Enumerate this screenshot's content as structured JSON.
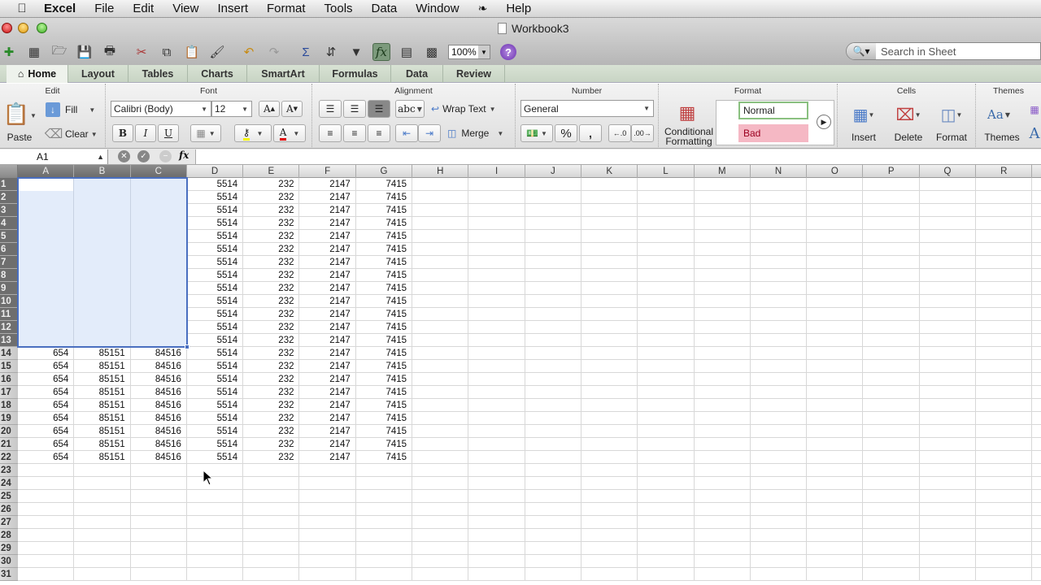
{
  "menubar": {
    "app": "Excel",
    "items": [
      "File",
      "Edit",
      "View",
      "Insert",
      "Format",
      "Tools",
      "Data",
      "Window",
      "Help"
    ]
  },
  "window": {
    "title": "Workbook3"
  },
  "toolbar": {
    "icons": [
      "new-icon",
      "templates-icon",
      "open-icon",
      "save-icon",
      "print-icon",
      "cut-icon",
      "copy-icon",
      "paste-icon",
      "format-painter-icon",
      "undo-icon",
      "redo-icon",
      "autosum-icon",
      "sort-icon",
      "filter-icon",
      "formula-builder-icon",
      "toolbox-icon",
      "media-browser-icon"
    ],
    "zoom": "100%",
    "help_label": "?",
    "search_placeholder": "Search in Sheet"
  },
  "tabs": [
    {
      "label": "Home",
      "active": true
    },
    {
      "label": "Layout"
    },
    {
      "label": "Tables"
    },
    {
      "label": "Charts"
    },
    {
      "label": "SmartArt"
    },
    {
      "label": "Formulas"
    },
    {
      "label": "Data"
    },
    {
      "label": "Review"
    }
  ],
  "ribbon": {
    "edit": {
      "title": "Edit",
      "paste": "Paste",
      "fill": "Fill",
      "clear": "Clear"
    },
    "font": {
      "title": "Font",
      "family": "Calibri (Body)",
      "size": "12",
      "bold": "B",
      "italic": "I",
      "underline": "U",
      "fill_color": "#f5f500",
      "font_color": "#e00000"
    },
    "alignment": {
      "title": "Alignment",
      "wrap_text": "Wrap Text",
      "merge": "Merge",
      "orientation": "abc"
    },
    "number": {
      "title": "Number",
      "format": "General",
      "percent": "%",
      "comma": ","
    },
    "format": {
      "title": "Format",
      "conditional": "Conditional",
      "formatting": "Formatting",
      "style_normal": "Normal",
      "style_bad": "Bad"
    },
    "cells": {
      "title": "Cells",
      "insert": "Insert",
      "delete": "Delete",
      "format": "Format"
    },
    "themes": {
      "title": "Themes",
      "themes": "Themes"
    }
  },
  "formula_bar": {
    "name_box": "A1",
    "fx": "fx",
    "value": ""
  },
  "sheet": {
    "columns": [
      "A",
      "B",
      "C",
      "D",
      "E",
      "F",
      "G",
      "H",
      "I",
      "J",
      "K",
      "L",
      "M",
      "N",
      "O",
      "P",
      "Q",
      "R"
    ],
    "selected_columns": [
      "A",
      "B",
      "C"
    ],
    "selected_rows": [
      1,
      13
    ],
    "active_cell": "A1",
    "rows_visible": 31,
    "data": [
      [
        "",
        "",
        "",
        "5514",
        "232",
        "2147",
        "7415"
      ],
      [
        "",
        "",
        "",
        "5514",
        "232",
        "2147",
        "7415"
      ],
      [
        "",
        "",
        "",
        "5514",
        "232",
        "2147",
        "7415"
      ],
      [
        "",
        "",
        "",
        "5514",
        "232",
        "2147",
        "7415"
      ],
      [
        "",
        "",
        "",
        "5514",
        "232",
        "2147",
        "7415"
      ],
      [
        "",
        "",
        "",
        "5514",
        "232",
        "2147",
        "7415"
      ],
      [
        "",
        "",
        "",
        "5514",
        "232",
        "2147",
        "7415"
      ],
      [
        "",
        "",
        "",
        "5514",
        "232",
        "2147",
        "7415"
      ],
      [
        "",
        "",
        "",
        "5514",
        "232",
        "2147",
        "7415"
      ],
      [
        "",
        "",
        "",
        "5514",
        "232",
        "2147",
        "7415"
      ],
      [
        "",
        "",
        "",
        "5514",
        "232",
        "2147",
        "7415"
      ],
      [
        "",
        "",
        "",
        "5514",
        "232",
        "2147",
        "7415"
      ],
      [
        "",
        "",
        "",
        "5514",
        "232",
        "2147",
        "7415"
      ],
      [
        "654",
        "85151",
        "84516",
        "5514",
        "232",
        "2147",
        "7415"
      ],
      [
        "654",
        "85151",
        "84516",
        "5514",
        "232",
        "2147",
        "7415"
      ],
      [
        "654",
        "85151",
        "84516",
        "5514",
        "232",
        "2147",
        "7415"
      ],
      [
        "654",
        "85151",
        "84516",
        "5514",
        "232",
        "2147",
        "7415"
      ],
      [
        "654",
        "85151",
        "84516",
        "5514",
        "232",
        "2147",
        "7415"
      ],
      [
        "654",
        "85151",
        "84516",
        "5514",
        "232",
        "2147",
        "7415"
      ],
      [
        "654",
        "85151",
        "84516",
        "5514",
        "232",
        "2147",
        "7415"
      ],
      [
        "654",
        "85151",
        "84516",
        "5514",
        "232",
        "2147",
        "7415"
      ],
      [
        "654",
        "85151",
        "84516",
        "5514",
        "232",
        "2147",
        "7415"
      ]
    ]
  }
}
